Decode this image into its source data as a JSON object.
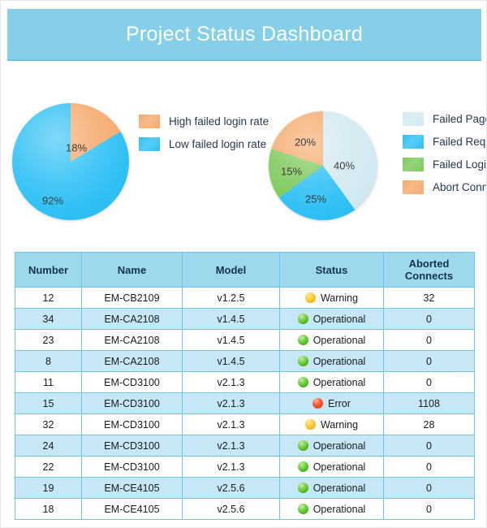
{
  "header": {
    "title": "Project Status Dashboard",
    "background_color": "#85cfe8",
    "text_color": "#ffffff"
  },
  "chart_data": [
    {
      "type": "pie",
      "name": "failed-login-rate-pie",
      "title": "",
      "legend_position": "right",
      "categories": [
        "High failed login rate",
        "Low failed login rate"
      ],
      "values": [
        18,
        92
      ],
      "labels": [
        "18%",
        "92%"
      ],
      "colors": [
        "#f5a96a",
        "#2ec0f5"
      ]
    },
    {
      "type": "pie",
      "name": "failure-breakdown-pie",
      "title": "",
      "legend_position": "right",
      "categories": [
        "Failed Pages",
        "Failed Req",
        "Failed Login",
        "Abort Connects"
      ],
      "values": [
        40,
        25,
        15,
        20
      ],
      "labels": [
        "40%",
        "25%",
        "15%",
        "20%"
      ],
      "colors": [
        "#d3e9f2",
        "#2ec0f5",
        "#7cc95a",
        "#f5a96a"
      ]
    }
  ],
  "table": {
    "columns": [
      "Number",
      "Name",
      "Model",
      "Status",
      "Aborted Connects"
    ],
    "rows": [
      {
        "number": "12",
        "name": "EM-CB2109",
        "model": "v1.2.5",
        "status": "Warning",
        "status_color": "yellow",
        "aborted": "32"
      },
      {
        "number": "34",
        "name": "EM-CA2108",
        "model": "v1.4.5",
        "status": "Operational",
        "status_color": "green",
        "aborted": "0"
      },
      {
        "number": "23",
        "name": "EM-CA2108",
        "model": "v1.4.5",
        "status": "Operational",
        "status_color": "green",
        "aborted": "0"
      },
      {
        "number": "8",
        "name": "EM-CA2108",
        "model": "v1.4.5",
        "status": "Operational",
        "status_color": "green",
        "aborted": "0"
      },
      {
        "number": "11",
        "name": "EM-CD3100",
        "model": "v2.1.3",
        "status": "Operational",
        "status_color": "green",
        "aborted": "0"
      },
      {
        "number": "15",
        "name": "EM-CD3100",
        "model": "v2.1.3",
        "status": "Error",
        "status_color": "red",
        "aborted": "1108"
      },
      {
        "number": "32",
        "name": "EM-CD3100",
        "model": "v2.1.3",
        "status": "Warning",
        "status_color": "yellow",
        "aborted": "28"
      },
      {
        "number": "24",
        "name": "EM-CD3100",
        "model": "v2.1.3",
        "status": "Operational",
        "status_color": "green",
        "aborted": "0"
      },
      {
        "number": "22",
        "name": "EM-CD3100",
        "model": "v2.1.3",
        "status": "Operational",
        "status_color": "green",
        "aborted": "0"
      },
      {
        "number": "19",
        "name": "EM-CE4105",
        "model": "v2.5.6",
        "status": "Operational",
        "status_color": "green",
        "aborted": "0"
      },
      {
        "number": "18",
        "name": "EM-CE4105",
        "model": "v2.5.6",
        "status": "Operational",
        "status_color": "green",
        "aborted": "0"
      }
    ]
  }
}
